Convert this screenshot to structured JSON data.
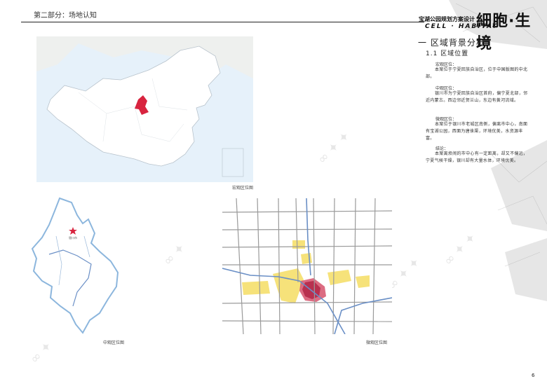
{
  "header": {
    "section_label": "第二部分：场地认知",
    "project_title": "宝湖公园规划方案设计",
    "brand_zh": "細胞·生境",
    "brand_en": "CELL · HABITAT"
  },
  "content": {
    "section_heading": "一  区域背景分析",
    "sub_heading": "1.1  区域位置",
    "paragraphs": [
      {
        "label": "宏观区位：",
        "body": "本案位于宁夏回族自治区，位于中国版图的中北部。"
      },
      {
        "label": "中观区位：",
        "body": "银川市为宁夏回族自治区首府，偏宁夏北部，邻近内蒙古。西边邻近贺兰山，东边有黄河流域。"
      },
      {
        "label": "微观区位：",
        "body": "本案位于银川市老城区南侧，偏离市中心，南面有宝湖公园，西面为唐徕渠，环境优美，水资源丰富。"
      },
      {
        "label": "结论：",
        "body": "本案离烦闹的市中心有一定距离，却又不偏远，宁夏气候干燥，银川却有大量水体，环境优美。"
      }
    ]
  },
  "maps": {
    "china_caption": "宏观区位图",
    "ningxia_caption": "中观区位图",
    "city_caption": "微观区位图",
    "city_marker_label": "银川市"
  },
  "colors": {
    "highlight_red": "#d8243f",
    "water_blue": "#8cb6dd",
    "river_blue": "#6a8fc6",
    "yellow_zone": "#f6e27a",
    "site_magenta": "#b8304f",
    "road_gray": "#9a9a9a"
  },
  "footer": {
    "page_number": "6"
  }
}
